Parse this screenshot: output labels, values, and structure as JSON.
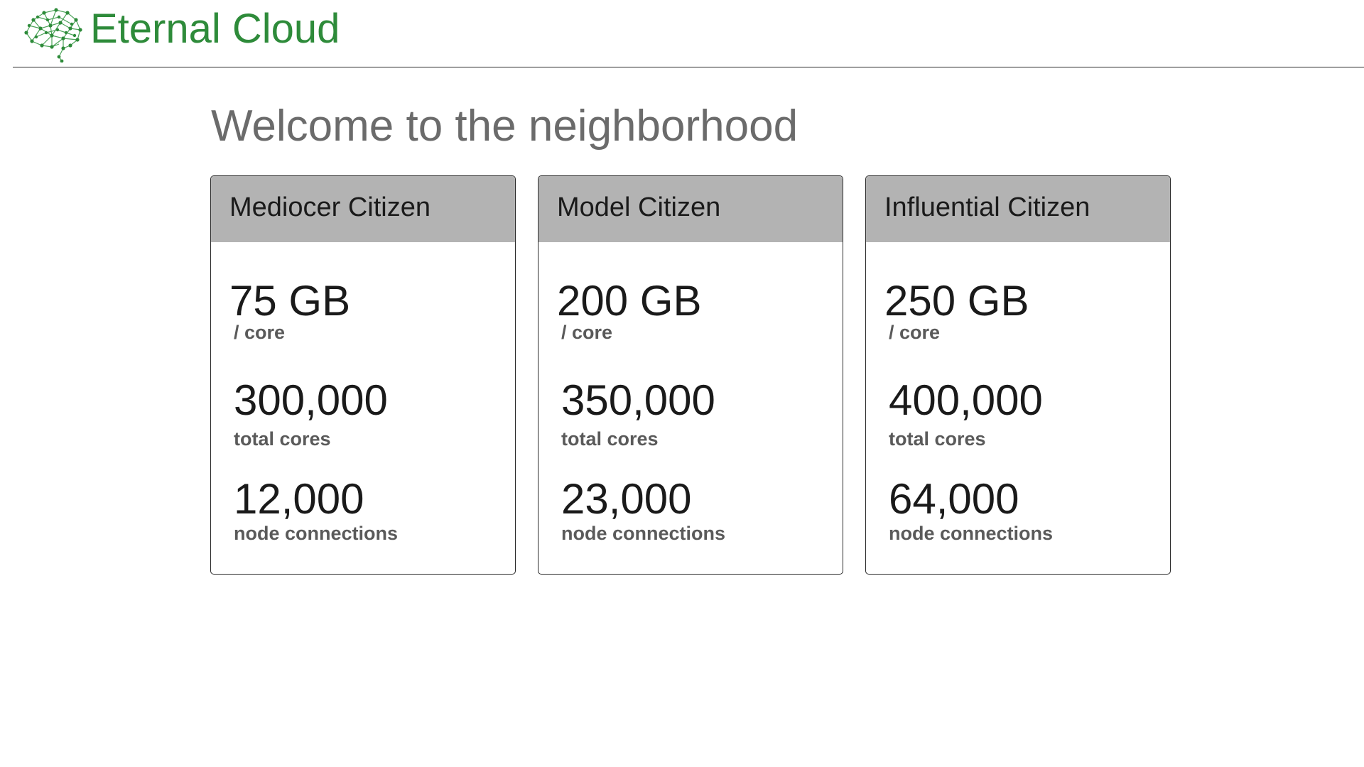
{
  "header": {
    "brand": "Eternal Cloud",
    "logo_icon": "brain-network-icon",
    "brand_color": "#2e8b3a"
  },
  "main": {
    "title": "Welcome to the neighborhood"
  },
  "plans": [
    {
      "name": "Mediocer Citizen",
      "storage_value": "75 GB",
      "storage_unit": "/ core",
      "cores_value": "300,000",
      "cores_label": "total cores",
      "connections_value": "12,000",
      "connections_label": "node connections"
    },
    {
      "name": "Model Citizen",
      "storage_value": "200 GB",
      "storage_unit": "/ core",
      "cores_value": "350,000",
      "cores_label": "total cores",
      "connections_value": "23,000",
      "connections_label": "node connections"
    },
    {
      "name": "Influential Citizen",
      "storage_value": "250 GB",
      "storage_unit": "/ core",
      "cores_value": "400,000",
      "cores_label": "total cores",
      "connections_value": "64,000",
      "connections_label": "node connections"
    }
  ],
  "colors": {
    "card_header": "#b3b3b3",
    "title_text": "#6b6b6b"
  }
}
